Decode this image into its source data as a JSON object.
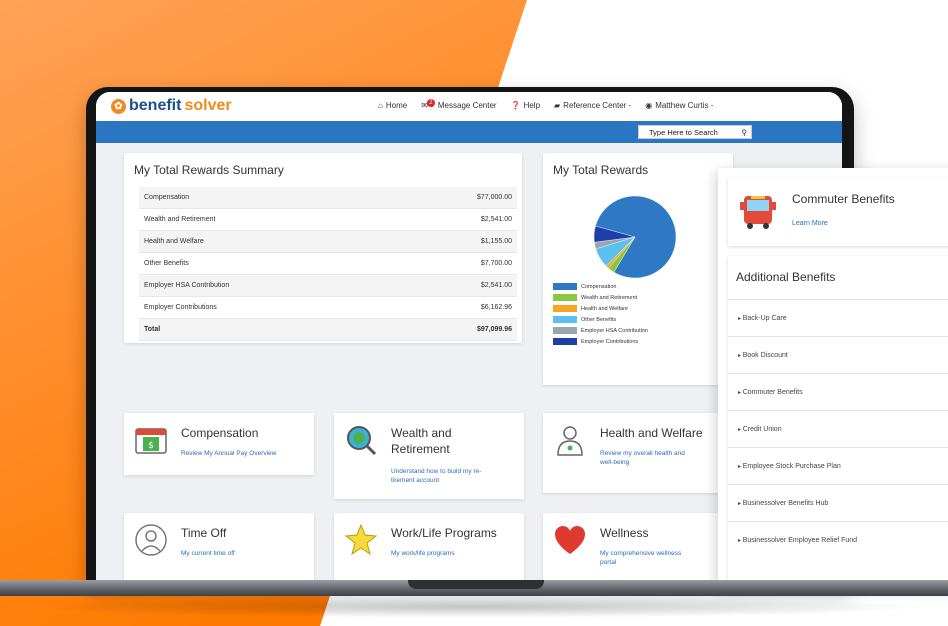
{
  "brand": {
    "name_a": "benefit",
    "name_b": "solver"
  },
  "nav": {
    "home": "Home",
    "message_center": "Message Center",
    "message_count": "2",
    "help": "Help",
    "reference_center": "Reference Center -",
    "user": "Matthew Curtis -"
  },
  "search": {
    "placeholder": "Type Here to Search"
  },
  "summary": {
    "title": "My Total Rewards Summary",
    "rows": [
      {
        "label": "Compensation",
        "value": "$77,000.00"
      },
      {
        "label": "Wealth and Retirement",
        "value": "$2,541.00"
      },
      {
        "label": "Health and Welfare",
        "value": "$1,155.00"
      },
      {
        "label": "Other Benefits",
        "value": "$7,700.00"
      },
      {
        "label": "Employer HSA Contribution",
        "value": "$2,541.00"
      },
      {
        "label": "Employer Contributions",
        "value": "$6,162.96"
      },
      {
        "label": "Total",
        "value": "$97,099.96"
      }
    ]
  },
  "rewards": {
    "title": "My Total Rewards"
  },
  "chart_data": {
    "type": "pie",
    "categories": [
      "Compensation",
      "Wealth and Retirement",
      "Health and Welfare",
      "Other Benefits",
      "Employer HSA Contribution",
      "Employer Contributions"
    ],
    "values": [
      77000.0,
      2541.0,
      1155.0,
      7700.0,
      2541.0,
      6162.96
    ],
    "colors": [
      "#2f78c4",
      "#8cc63f",
      "#f5a623",
      "#5bc0f0",
      "#9aa5ae",
      "#1e3fa8"
    ],
    "legend": "bottom"
  },
  "tiles": {
    "compensation": {
      "title": "Compensation",
      "link": "Review My Annual Pay Overview"
    },
    "wealth": {
      "title1": "Wealth and",
      "title2": "Retirement",
      "link1": "Understand how to build my re-",
      "link2": "tirement account"
    },
    "health": {
      "title": "Health and Welfare",
      "link1": "Review my overall health and",
      "link2": "well-being"
    },
    "timeoff": {
      "title": "Time Off",
      "link": "My current time off"
    },
    "worklife": {
      "title": "Work/Life Programs",
      "link": "My work/life programs"
    },
    "wellness": {
      "title": "Wellness",
      "link1": "My comprehensive wellness",
      "link2": "portal"
    }
  },
  "commuter": {
    "title": "Commuter Benefits",
    "link": "Learn More"
  },
  "additional": {
    "title": "Additional Benefits",
    "items": [
      "Back-Up Care",
      "Book Discount",
      "Commuter Benefits",
      "Credit Union",
      "Employee Stock Purchase Plan",
      "Businessolver Benefits Hub",
      "Businessolver Employee Relief Fund"
    ]
  }
}
